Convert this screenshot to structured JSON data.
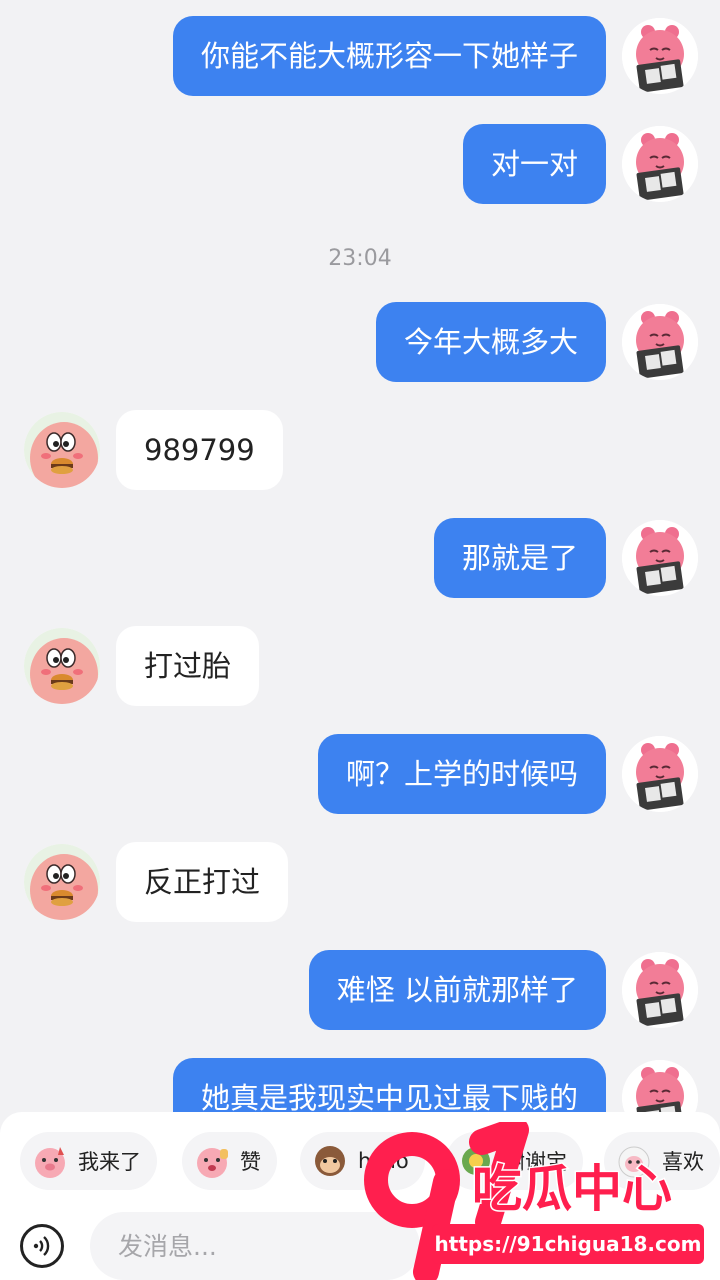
{
  "messages": [
    {
      "from": "me",
      "text": "你能不能大概形容一下她样子"
    },
    {
      "from": "me",
      "text": "对一对"
    },
    {
      "timestamp": "23:04"
    },
    {
      "from": "me",
      "text": "今年大概多大"
    },
    {
      "from": "other",
      "text": "989799"
    },
    {
      "from": "me",
      "text": "那就是了"
    },
    {
      "from": "other",
      "text": "打过胎"
    },
    {
      "from": "me",
      "text": "啊？上学的时候吗"
    },
    {
      "from": "other",
      "text": "反正打过"
    },
    {
      "from": "me",
      "text": "难怪 以前就那样了"
    },
    {
      "from": "me",
      "text": "她真是我现实中见过最下贱的"
    }
  ],
  "quick_replies": [
    {
      "label": "我来了",
      "icon": "pig-sticker-icon"
    },
    {
      "label": "赞",
      "icon": "pig-thumbs-sticker-icon"
    },
    {
      "label": "hello",
      "icon": "monkey-sticker-icon"
    },
    {
      "label": "谢谢宝",
      "icon": "flower-sticker-icon"
    },
    {
      "label": "喜欢",
      "icon": "sheep-sticker-icon"
    }
  ],
  "composer": {
    "placeholder": "发消息..."
  },
  "watermark": {
    "number": "91",
    "name": "吃瓜中心",
    "url": "https://91chigua18.com"
  },
  "colors": {
    "my_bubble": "#3d82f0",
    "other_bubble": "#ffffff",
    "background": "#f2f2f4",
    "watermark": "#ff1f4e"
  }
}
